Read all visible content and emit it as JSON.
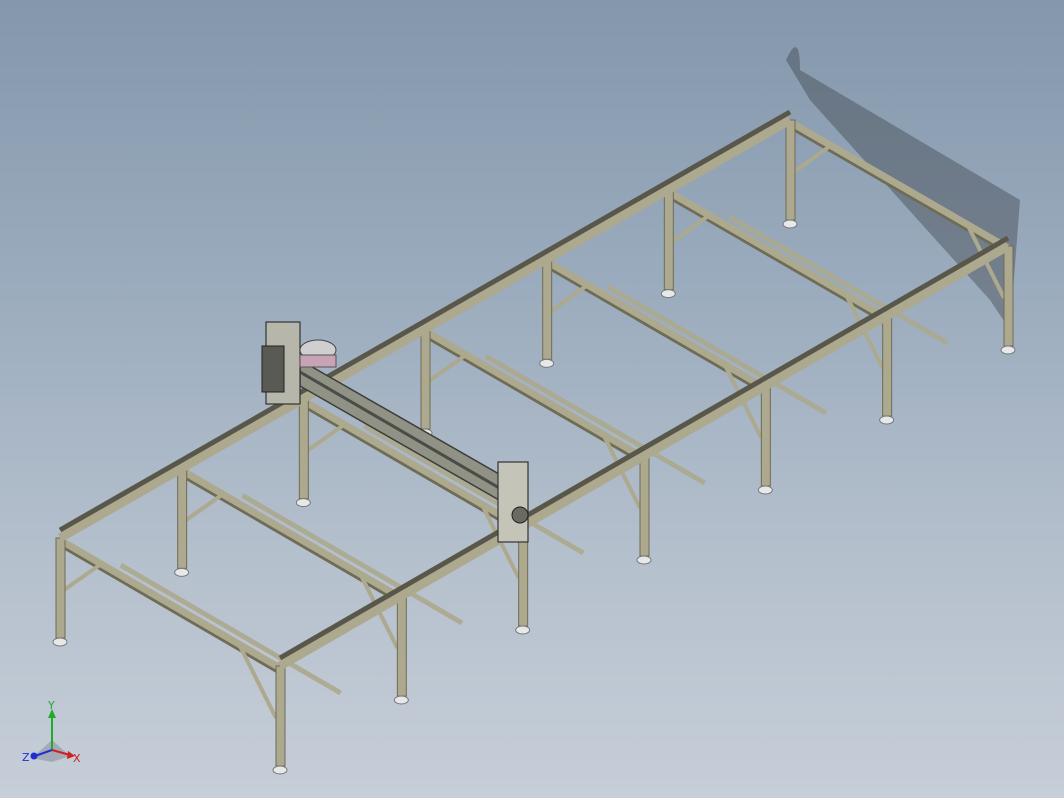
{
  "viewport": {
    "background_top": "#8497ab",
    "background_bottom": "#c6ced8"
  },
  "model": {
    "frame_color": "#aca98e",
    "frame_dark": "#6f6c56",
    "rail_color": "#58574a",
    "beam_color": "#8f9285",
    "foot_color": "#e6e8ea",
    "accent_pink": "#c8a3b5"
  },
  "triad": {
    "y_label": "Y",
    "x_label": "X",
    "z_label": "Z",
    "y_color": "#1faa2a",
    "x_color": "#d02020",
    "z_color": "#2030d0"
  }
}
